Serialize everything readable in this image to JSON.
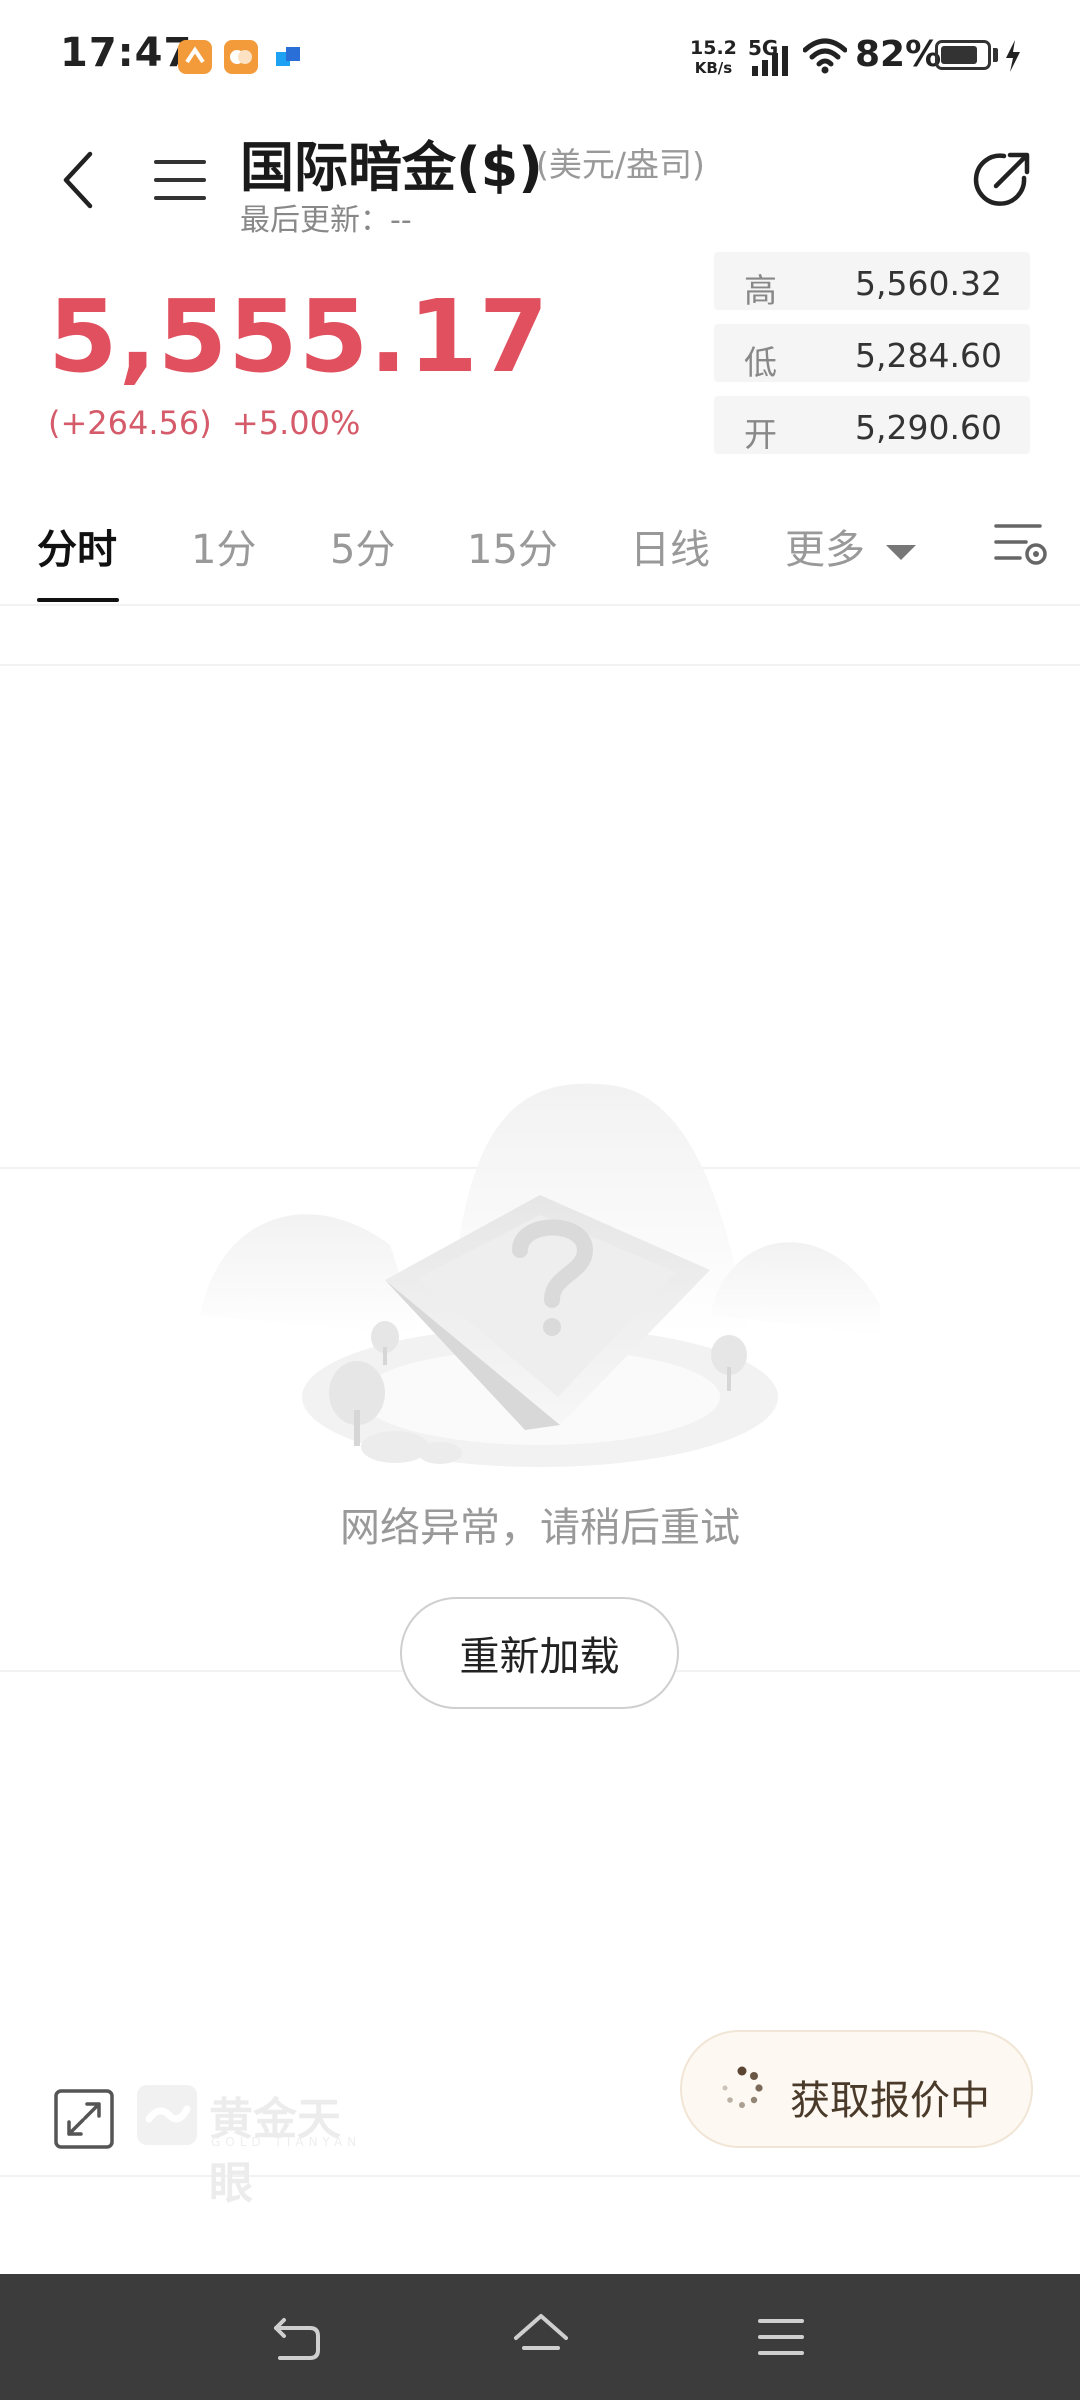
{
  "status_bar": {
    "time": "17:47",
    "net_speed_value": "15.2",
    "net_speed_unit": "KB/s",
    "signal_label": "5G",
    "battery_percent": "82%",
    "battery_level": 0.82
  },
  "header": {
    "title": "国际暗金($)",
    "unit": "(美元/盎司)",
    "last_updated": "最后更新：--",
    "icons": [
      "back-arrow-icon",
      "menu-icon",
      "share-icon"
    ]
  },
  "quote": {
    "price": "5,555.17",
    "change": "(+264.56)",
    "change_pct": "+5.00%",
    "price_color": "#e0505e",
    "stats": [
      {
        "label": "高",
        "value": "5,560.32"
      },
      {
        "label": "低",
        "value": "5,284.60"
      },
      {
        "label": "开",
        "value": "5,290.60"
      }
    ]
  },
  "tabs": {
    "items": [
      "分时",
      "1分",
      "5分",
      "15分",
      "日线",
      "更多"
    ],
    "active": "分时",
    "settings_icon": "chart-settings-icon"
  },
  "empty_state": {
    "message": "网络异常，请稍后重试",
    "reload_label": "重新加载"
  },
  "chart_toolbar": {
    "expand_icon": "expand-icon",
    "brand_cn": "黄金天眼",
    "brand_en": "GOLD TIANYAN",
    "quote_status": "获取报价中"
  },
  "nav_bar": {
    "icons": [
      "back-icon",
      "home-icon",
      "recents-menu-icon"
    ]
  }
}
